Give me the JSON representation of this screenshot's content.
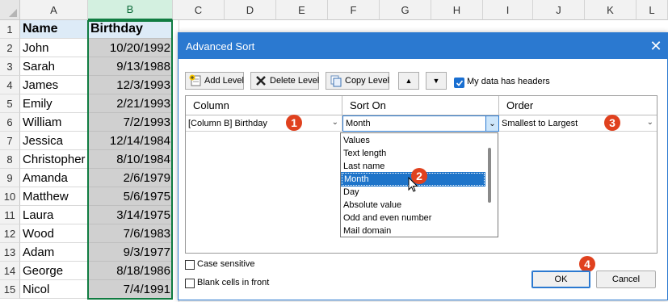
{
  "spreadsheet": {
    "columns": [
      "A",
      "B",
      "C",
      "D",
      "E",
      "F",
      "G",
      "H",
      "I",
      "J",
      "K",
      "L"
    ],
    "rows": [
      {
        "num": "1",
        "name": "Name",
        "birthday": "Birthday"
      },
      {
        "num": "2",
        "name": "John",
        "birthday": "10/20/1992"
      },
      {
        "num": "3",
        "name": "Sarah",
        "birthday": "9/13/1988"
      },
      {
        "num": "4",
        "name": "James",
        "birthday": "12/3/1993"
      },
      {
        "num": "5",
        "name": "Emily",
        "birthday": "2/21/1993"
      },
      {
        "num": "6",
        "name": "William",
        "birthday": "7/2/1993"
      },
      {
        "num": "7",
        "name": "Jessica",
        "birthday": "12/14/1984"
      },
      {
        "num": "8",
        "name": "Christopher",
        "birthday": "8/10/1984"
      },
      {
        "num": "9",
        "name": "Amanda",
        "birthday": "2/6/1979"
      },
      {
        "num": "10",
        "name": "Matthew",
        "birthday": "5/6/1975"
      },
      {
        "num": "11",
        "name": "Laura",
        "birthday": "3/14/1975"
      },
      {
        "num": "12",
        "name": "Wood",
        "birthday": "7/6/1983"
      },
      {
        "num": "13",
        "name": "Adam",
        "birthday": "9/3/1977"
      },
      {
        "num": "14",
        "name": "George",
        "birthday": "8/18/1986"
      },
      {
        "num": "15",
        "name": "Nicol",
        "birthday": "7/4/1991"
      }
    ]
  },
  "dialog": {
    "title": "Advanced Sort",
    "close_glyph": "✕",
    "toolbar": {
      "add_level": "Add Level",
      "delete_level": "Delete Level",
      "copy_level": "Copy Level",
      "move_up_glyph": "▲",
      "move_down_glyph": "▼",
      "has_headers_label": "My data has headers",
      "has_headers_checked": true
    },
    "table": {
      "headers": {
        "column": "Column",
        "sort_on": "Sort On",
        "order": "Order"
      },
      "level": {
        "column": "[Column B] Birthday",
        "sort_on": "Month",
        "order": "Smallest to Largest"
      }
    },
    "sort_on_options": [
      "Values",
      "Text length",
      "Last name",
      "Month",
      "Day",
      "Absolute value",
      "Odd and even number",
      "Mail domain"
    ],
    "sort_on_selected": "Month",
    "case_sensitive_label": "Case sensitive",
    "blank_cells_label": "Blank cells in front",
    "ok_label": "OK",
    "cancel_label": "Cancel"
  },
  "badges": [
    "1",
    "2",
    "3",
    "4"
  ],
  "colors": {
    "accent": "#2b79d0",
    "badge": "#e0411e",
    "selection": "#107c41",
    "header_fill": "#ddebf7"
  }
}
